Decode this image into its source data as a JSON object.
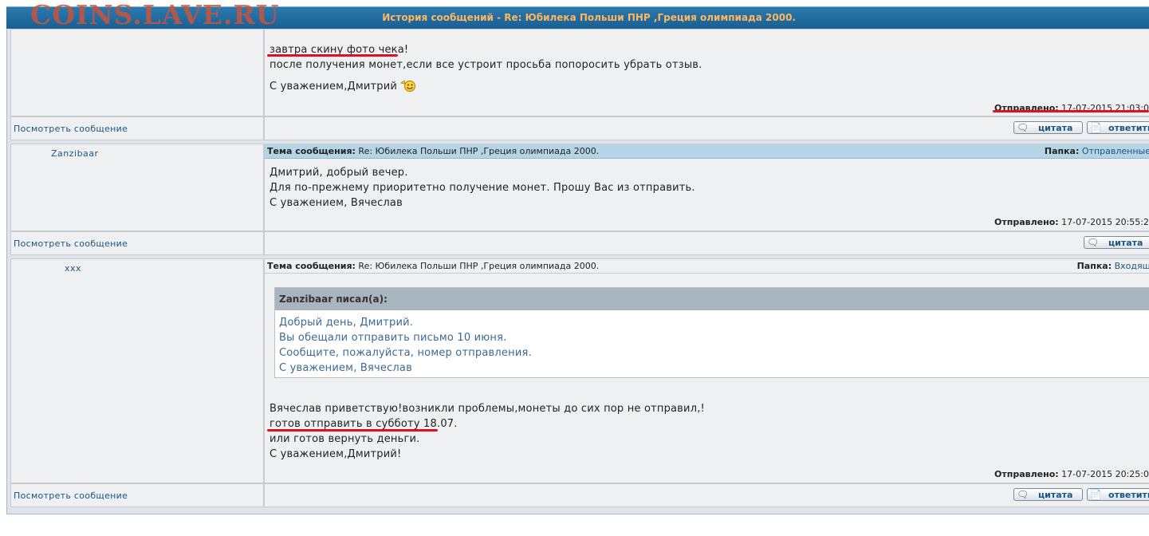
{
  "watermark": "COINS.LAVE.RU",
  "window": {
    "title": "История сообщений - Re: Юбилека Польши ПНР ,Греция олимпиада 2000."
  },
  "labels": {
    "view_message": "Посмотреть сообщение",
    "subject_prefix": "Тема сообщения:",
    "folder_prefix": "Папка:",
    "sent_prefix": "Отправлено:",
    "quote_button": "цитата",
    "reply_button": "ответить"
  },
  "messages": [
    {
      "author": "",
      "lines": [
        "завтра скину фото чека!",
        "после получения монет,если все устроит просьба попоросить убрать отзыв.",
        "С уважением,Дмитрий"
      ],
      "emoticon": "smiley-icon",
      "sent": "17-07-2015 21:03:0",
      "buttons": [
        "цитата",
        "ответить"
      ]
    },
    {
      "author": "Zanzibaar",
      "subject": "Re: Юбилека Польши ПНР ,Греция олимпиада 2000.",
      "folder": "Отправленные",
      "lines": [
        "Дмитрий, добрый вечер.",
        "Для по-прежнему приоритетно получение монет. Прошу Вас из отправить.",
        "С уважением, Вячеслав"
      ],
      "sent": "17-07-2015 20:55:2",
      "buttons": [
        "цитата"
      ]
    },
    {
      "author": "xxx",
      "subject": "Re: Юбилека Польши ПНР ,Греция олимпиада 2000.",
      "folder": "Входящ",
      "quote": {
        "header": "Zanzibaar писал(а):",
        "lines": [
          "Добрый день, Дмитрий.",
          "Вы обещали отправить письмо 10 июня.",
          "Сообщите, пожалуйста, номер отправления.",
          "С уважением, Вячеслав"
        ]
      },
      "lines": [
        "Вячеслав приветствую!возникли проблемы,монеты до сих пор не отправил,!",
        "готов отправить в субботу 18.07.",
        "или готов вернуть деньги.",
        "С уважением,Дмитрий!"
      ],
      "sent": "17-07-2015 20:25:0",
      "buttons": [
        "цитата",
        "ответить"
      ]
    }
  ],
  "colors": {
    "titlebar": "#1f6a9e",
    "title_text": "#ffb65c",
    "subject_bar": "#b4d5e6",
    "annotation_red": "#e01020",
    "link": "#1a5580"
  }
}
